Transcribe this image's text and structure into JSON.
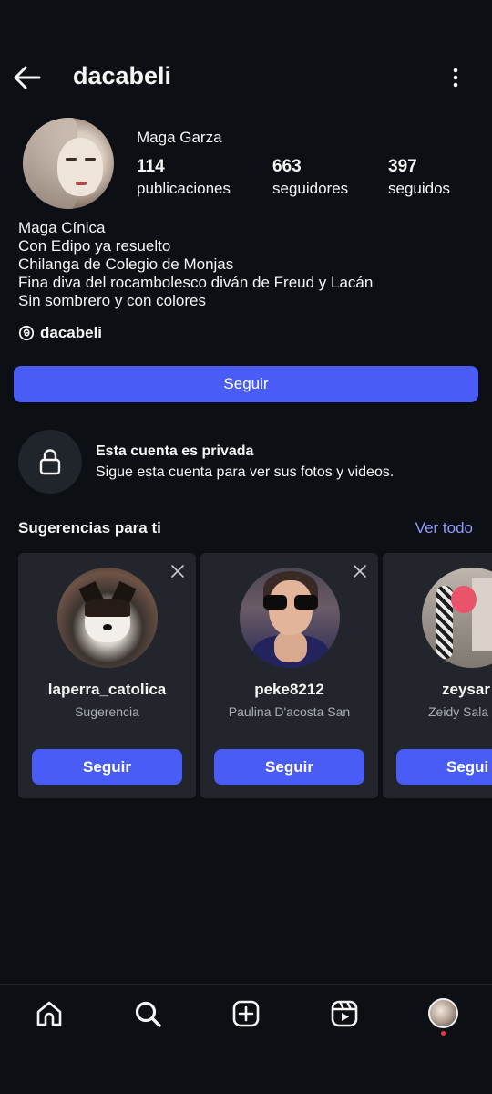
{
  "header": {
    "username": "dacabeli"
  },
  "profile": {
    "full_name": "Maga Garza",
    "stats": [
      {
        "value": "114",
        "label": "publicaciones"
      },
      {
        "value": "663",
        "label": "seguidores"
      },
      {
        "value": "397",
        "label": "seguidos"
      }
    ],
    "bio": [
      "Maga Cínica",
      "Con Edipo ya resuelto",
      "Chilanga de Colegio de Monjas",
      "Fina diva del rocambolesco diván de Freud y Lacán",
      "Sin sombrero y con colores"
    ],
    "threads_handle": "dacabeli",
    "follow_label": "Seguir"
  },
  "private": {
    "title": "Esta cuenta es privada",
    "subtitle": "Sigue esta cuenta para ver sus fotos y videos."
  },
  "suggestions": {
    "title": "Sugerencias para ti",
    "see_all": "Ver todo",
    "cards": [
      {
        "username": "laperra_catolica",
        "subtitle": "Sugerencia",
        "button": "Seguir"
      },
      {
        "username": "peke8212",
        "subtitle": "Paulina D'acosta San",
        "button": "Seguir"
      },
      {
        "username": "zeysar",
        "subtitle": "Zeidy Sala",
        "button": "Segui"
      }
    ]
  },
  "colors": {
    "accent": "#4a5cf6",
    "link": "#8c9dff",
    "background": "#0c0f14",
    "card": "#22262c",
    "notification": "#ff3040"
  },
  "icons": {
    "back": "arrow-left-icon",
    "menu": "more-vertical-icon",
    "threads": "threads-icon",
    "lock": "lock-icon",
    "close": "close-icon",
    "nav": [
      "home-icon",
      "search-icon",
      "create-icon",
      "reels-icon",
      "profile-avatar"
    ]
  }
}
